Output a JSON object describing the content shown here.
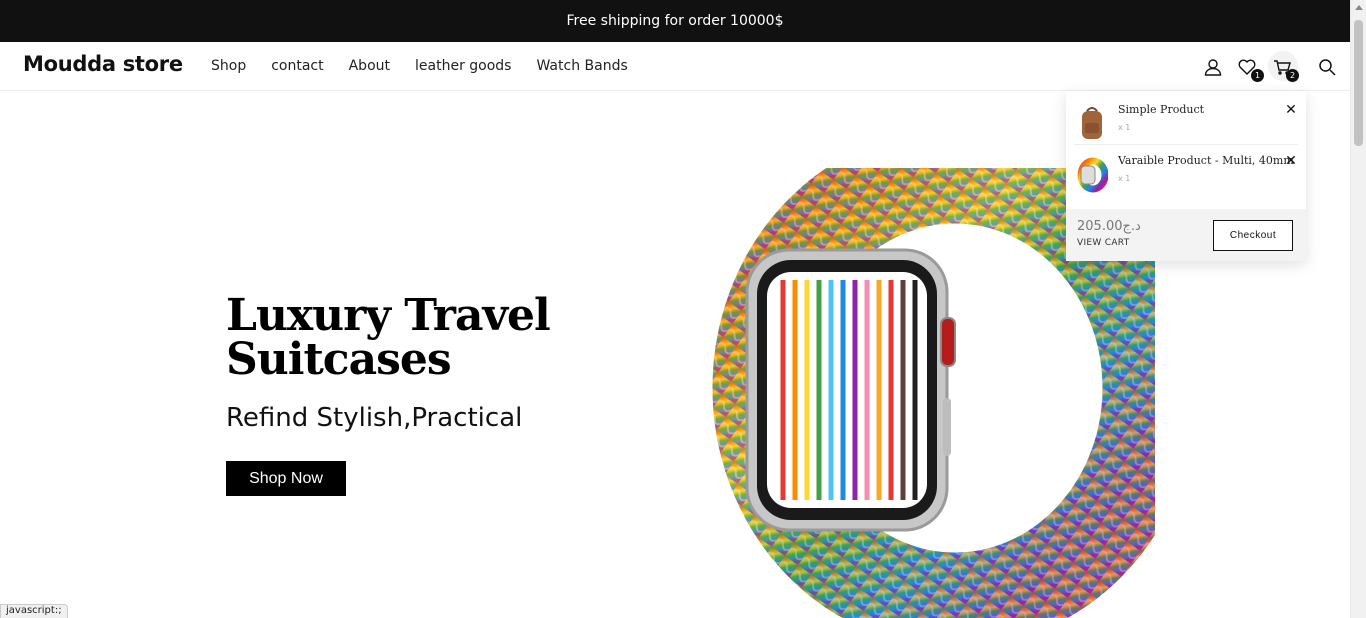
{
  "announcement": "Free shipping for order 10000$",
  "header": {
    "logo": "Moudda store",
    "nav": [
      "Shop",
      "contact",
      "About",
      "leather goods",
      "Watch Bands"
    ],
    "wishlist_count": "1",
    "cart_count": "2"
  },
  "hero": {
    "title": "Luxury Travel Suitcases",
    "subtitle": "Refind Stylish,Practical",
    "button": "Shop Now"
  },
  "cart": {
    "items": [
      {
        "name": "Simple Product",
        "qty": "x 1"
      },
      {
        "name": "Varaible Product - Multi, 40mm",
        "qty": "x 1"
      }
    ],
    "total": "205.00د.ج",
    "view_cart": "VIEW CART",
    "checkout": "Checkout"
  },
  "status_tip": "javascript:;",
  "colors": {
    "topbar": "#111111",
    "accent": "#000000"
  }
}
